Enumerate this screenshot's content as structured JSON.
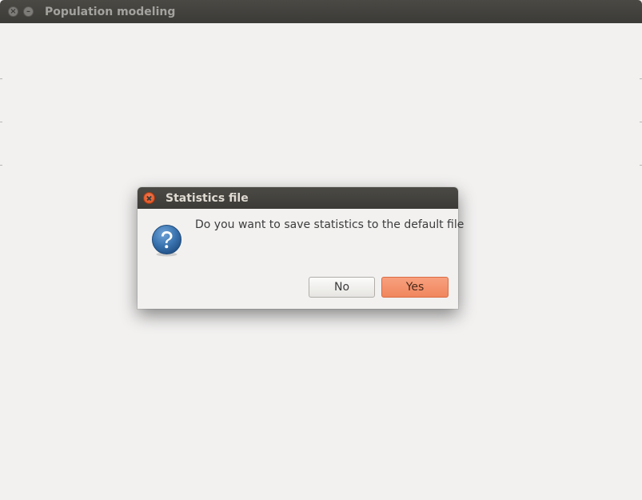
{
  "window": {
    "title": "Population modeling",
    "close_glyph": "×",
    "minimize_glyph": "–"
  },
  "dialog": {
    "title": "Statistics file",
    "message": "Do you want to save statistics to the default file",
    "icon": "question-icon",
    "buttons": {
      "no_label": "No",
      "yes_label": "Yes"
    }
  },
  "colors": {
    "titlebar": "#3c3b37",
    "background": "#f2f1f0",
    "accent": "#f0865e",
    "close_button": "#df4a16",
    "question_icon": "#3a74b0"
  }
}
